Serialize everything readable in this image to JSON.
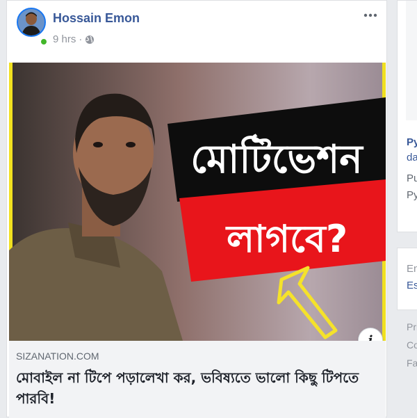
{
  "post": {
    "author": "Hossain Emon",
    "time": "9 hrs",
    "separator": "·",
    "privacy_icon": "globe-icon",
    "more_icon": "ellipsis-icon",
    "image": {
      "overlay_line1": "মোটিভেশন",
      "overlay_line2": "লাগবে?",
      "info_label": "i"
    },
    "link": {
      "domain": "SIZANATION.COM",
      "headline": "মোবাইল না টিপে পড়ালেখা কর, ভবিষ্যতে ভালো কিছু টিপতে পারবি!"
    }
  },
  "sidebar": {
    "item1_line1": "Py",
    "item1_line2": "da",
    "item1_line3": "Pu",
    "item1_line4": "Py",
    "lang_line1": "En",
    "lang_line2": "Es",
    "footer_line1": "Pri",
    "footer_line2": "Co",
    "footer_line3": "Fa"
  },
  "colors": {
    "link_blue": "#385898",
    "secondary": "#90949c",
    "online": "#42b72a",
    "overlay_red": "#e8151b"
  }
}
